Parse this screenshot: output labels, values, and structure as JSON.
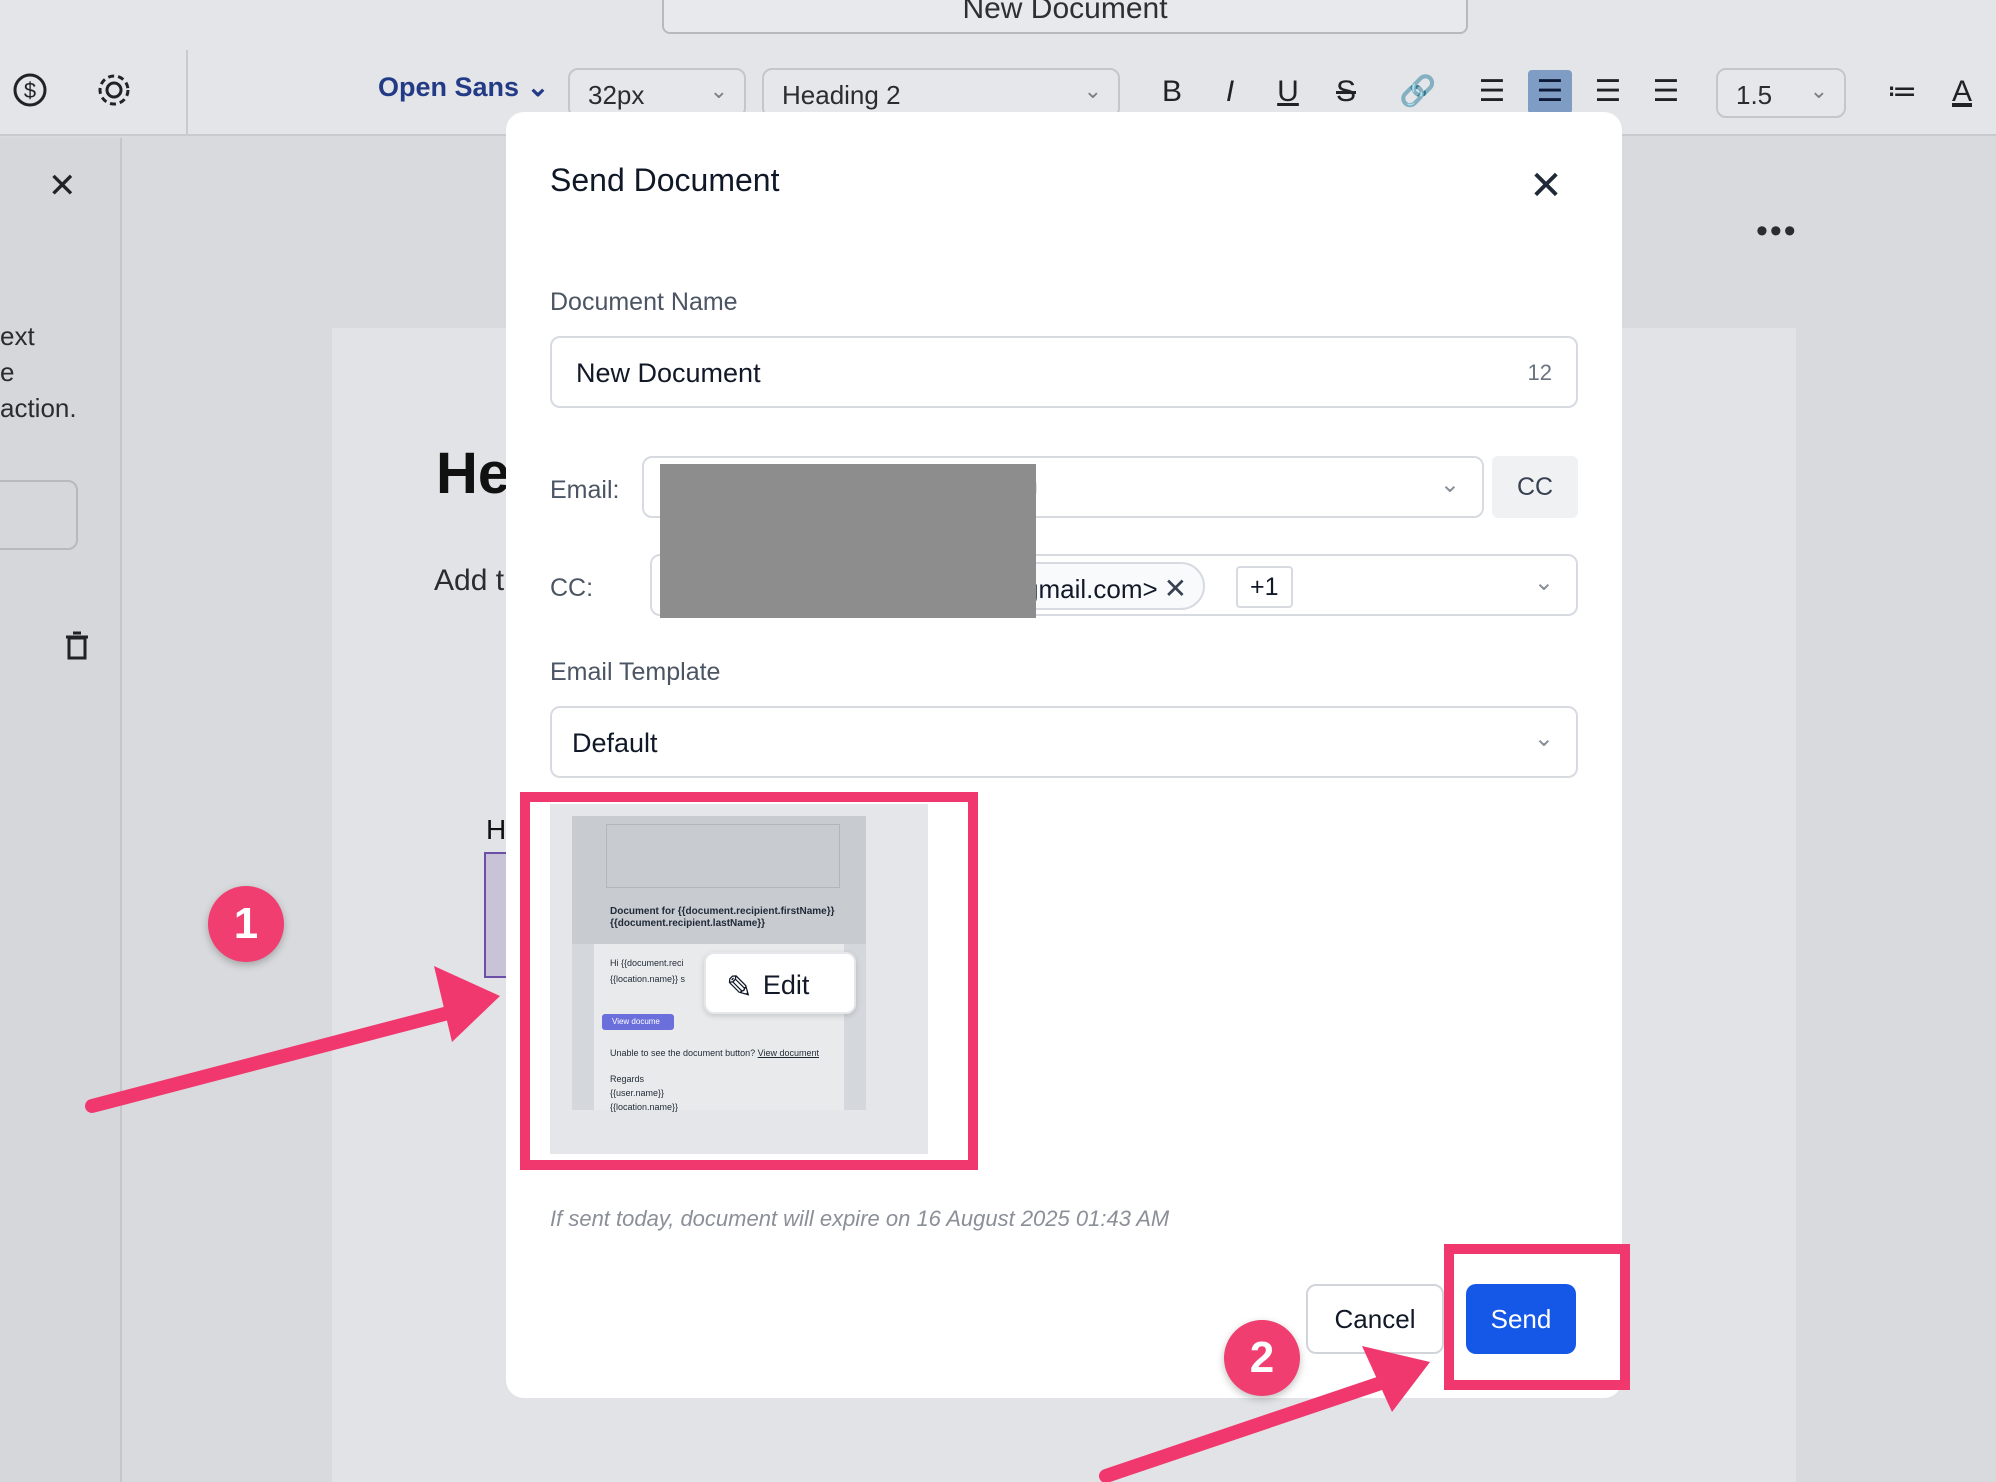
{
  "window": {
    "doc_title": "New Document"
  },
  "toolbar": {
    "font_family": "Open Sans",
    "font_size": "32px",
    "block_style": "Heading 2",
    "line_height": "1.5",
    "icons": [
      "dollar-icon",
      "gear-icon",
      "bold-icon",
      "italic-icon",
      "underline-icon",
      "strikethrough-icon",
      "link-icon",
      "justify-icon",
      "align-left-icon",
      "align-center-icon",
      "align-right-icon",
      "list-icon",
      "text-color-icon"
    ],
    "bold": "B",
    "italic": "I",
    "underline": "U",
    "strike": "S",
    "text_color": "A"
  },
  "side_panel": {
    "text_lines": [
      "ext",
      "e",
      "action."
    ]
  },
  "background_doc": {
    "heading": "He",
    "body": "Add t",
    "block_label": "H"
  },
  "modal": {
    "title": "Send Document",
    "document_name_label": "Document Name",
    "document_name_value": "New Document",
    "document_name_count": "12",
    "email_label": "Email:",
    "email_chip_visible": ">",
    "cc_button": "CC",
    "cc_label": "CC:",
    "cc_chip_visible": "gmail.com>",
    "cc_more": "+1",
    "template_label": "Email Template",
    "template_value": "Default",
    "preview": {
      "heading_line1": "Document for {{document.recipient.firstName}}",
      "heading_line2": "{{document.recipient.lastName}}",
      "hi_line": "Hi {{document.reci",
      "loc_line": "{{location.name}} s",
      "button": "View docume",
      "unable_text": "Unable to see the document button?",
      "unable_link": "View document",
      "regards": "Regards",
      "user_name": "{{user.name}}",
      "location_name": "{{location.name}}",
      "edit_label": "Edit"
    },
    "expiry_text": "If sent today, document will expire on 16 August 2025 01:43 AM",
    "cancel_label": "Cancel",
    "send_label": "Send"
  },
  "annotations": {
    "badge1": "1",
    "badge2": "2",
    "color": "#f0386f"
  },
  "colors": {
    "primary": "#1558e8",
    "accent_font": "#233b86",
    "annotation": "#f0386f"
  }
}
